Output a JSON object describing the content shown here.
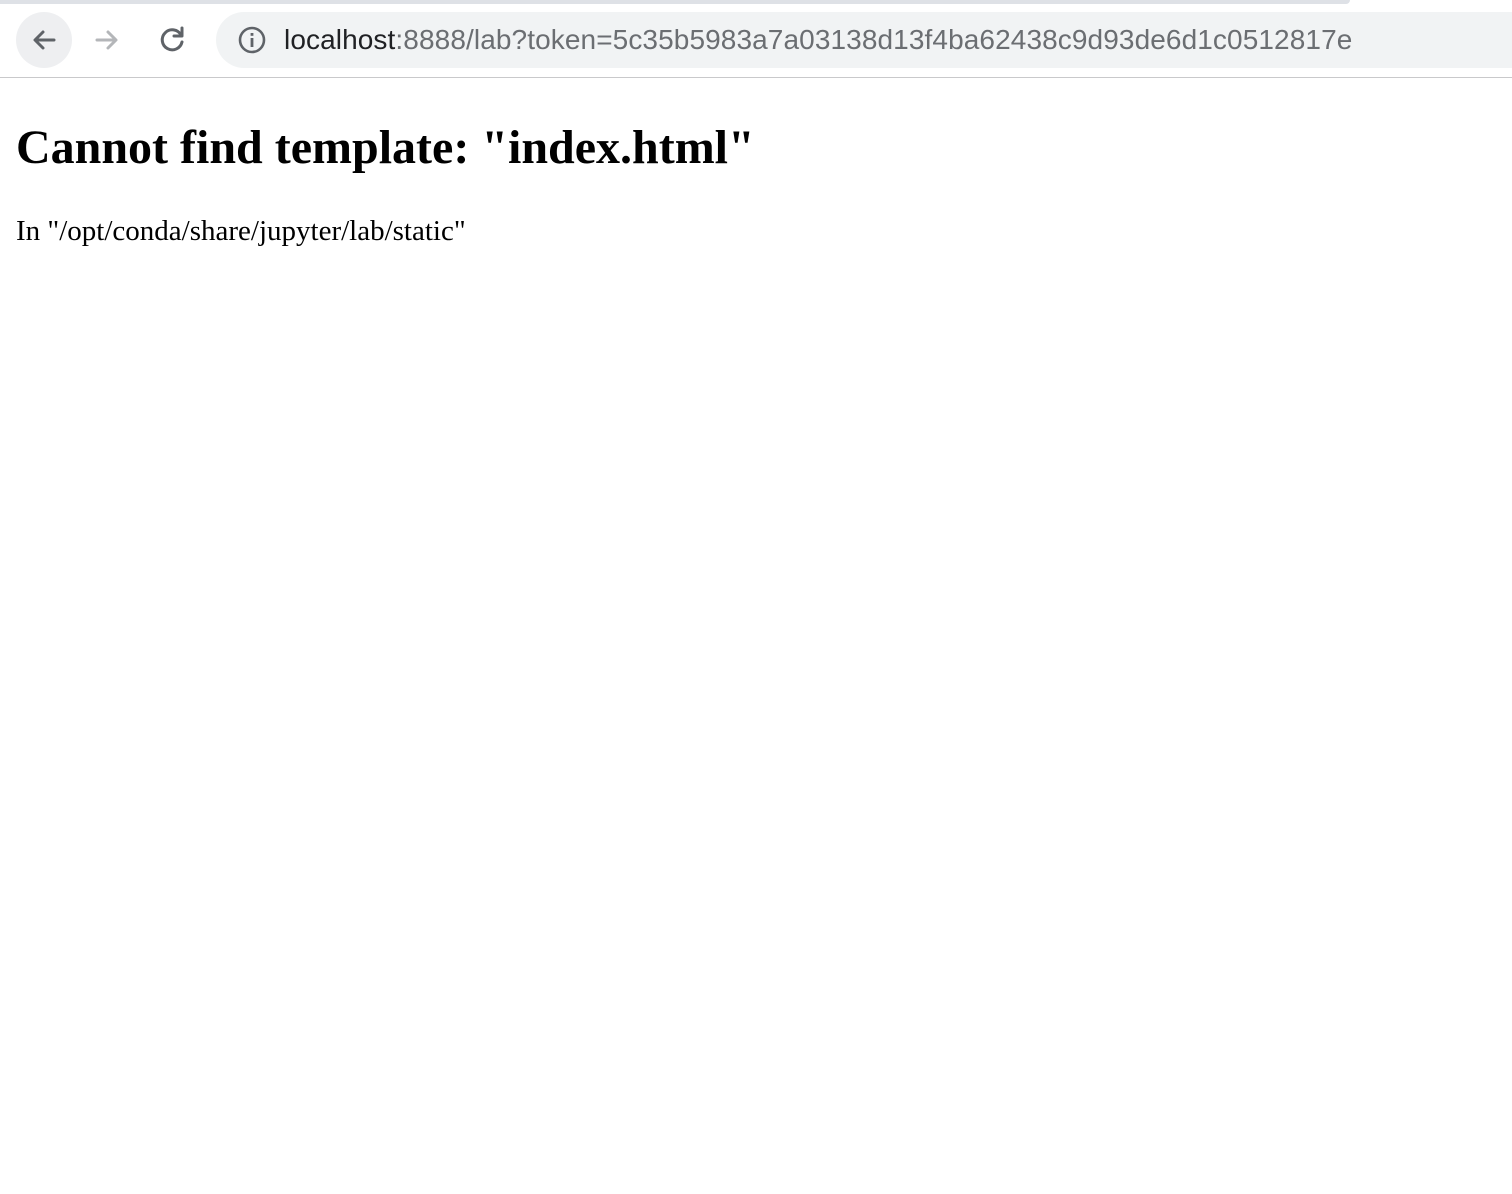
{
  "browser": {
    "url_host": "localhost",
    "url_rest": ":8888/lab?token=5c35b5983a7a03138d13f4ba62438c9d93de6d1c0512817e",
    "icons": {
      "back": "arrow-left-icon",
      "forward": "arrow-right-icon",
      "reload": "reload-icon",
      "site_info": "info-circle-icon"
    }
  },
  "page": {
    "title": "Cannot find template: \"index.html\"",
    "detail": "In \"/opt/conda/share/jupyter/lab/static\""
  }
}
